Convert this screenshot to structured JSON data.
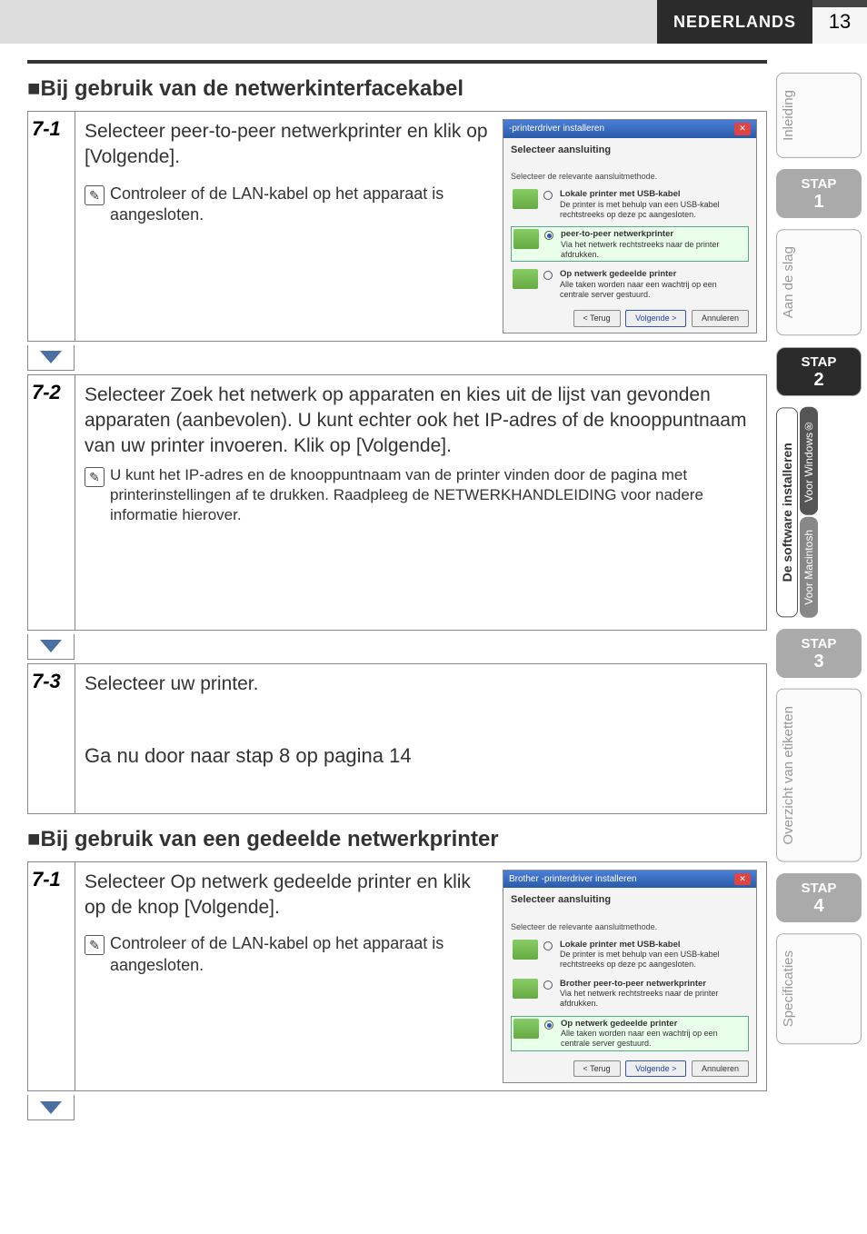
{
  "header": {
    "language": "NEDERLANDS",
    "page": "13"
  },
  "section1": {
    "title": "■Bij gebruik van de netwerkinterfacekabel"
  },
  "s71": {
    "num": "7-1",
    "text": "Selecteer peer-to-peer netwerkprinter en klik op [Volgende].",
    "note": "Controleer of de LAN-kabel op het apparaat is aangesloten."
  },
  "s72": {
    "num": "7-2",
    "text": "Selecteer Zoek het netwerk op apparaten en kies uit de lijst van gevonden apparaten (aanbevolen). U kunt echter ook het IP-adres of de knooppuntnaam van uw printer invoeren. Klik op [Volgende].",
    "note": "U kunt het IP-adres en de knooppuntnaam van de printer vinden door de pagina met printerinstellingen af te drukken. Raadpleeg de NETWERKHANDLEIDING voor nadere informatie hierover."
  },
  "s73": {
    "num": "7-3",
    "text": "Selecteer uw printer.",
    "goto": "Ga nu door naar stap 8 op pagina 14"
  },
  "section2": {
    "title": "■Bij gebruik van een gedeelde netwerkprinter"
  },
  "s71b": {
    "num": "7-1",
    "text": "Selecteer Op netwerk gedeelde printer en klik op de knop [Volgende].",
    "note": "Controleer of de LAN-kabel op het apparaat is aangesloten."
  },
  "dialog1": {
    "title": "-printerdriver installeren",
    "h": "Selecteer aansluiting",
    "sub": "Selecteer de relevante aansluitmethode.",
    "opt1_t": "Lokale printer met USB-kabel",
    "opt1_d": "De printer is met behulp van een USB-kabel rechtstreeks op deze pc aangesloten.",
    "opt2_t": "peer-to-peer netwerkprinter",
    "opt2_d": "Via het netwerk rechtstreeks naar de printer afdrukken.",
    "opt3_t": "Op netwerk gedeelde printer",
    "opt3_d": "Alle taken worden naar een wachtrij op een centrale server gestuurd.",
    "back": "< Terug",
    "next": "Volgende >",
    "cancel": "Annuleren"
  },
  "dialog2": {
    "title": "Brother -printerdriver installeren",
    "h": "Selecteer aansluiting",
    "sub": "Selecteer de relevante aansluitmethode.",
    "opt1_t": "Lokale printer met USB-kabel",
    "opt1_d": "De printer is met behulp van een USB-kabel rechtstreeks op deze pc aangesloten.",
    "opt2_t": "Brother peer-to-peer netwerkprinter",
    "opt2_d": "Via het netwerk rechtstreeks naar de printer afdrukken.",
    "opt3_t": "Op netwerk gedeelde printer",
    "opt3_d": "Alle taken worden naar een wachtrij op een centrale server gestuurd.",
    "back": "< Terug",
    "next": "Volgende >",
    "cancel": "Annuleren"
  },
  "tabs": {
    "inleiding": "Inleiding",
    "stap1": "STAP",
    "n1": "1",
    "aandeslag": "Aan de slag",
    "stap2": "STAP",
    "n2": "2",
    "software": "De software installeren",
    "windows": "Voor Windows®",
    "mac": "Voor Macintosh",
    "stap3": "STAP",
    "n3": "3",
    "etiketten": "Overzicht van etiketten",
    "stap4": "STAP",
    "n4": "4",
    "spec": "Specificaties"
  }
}
